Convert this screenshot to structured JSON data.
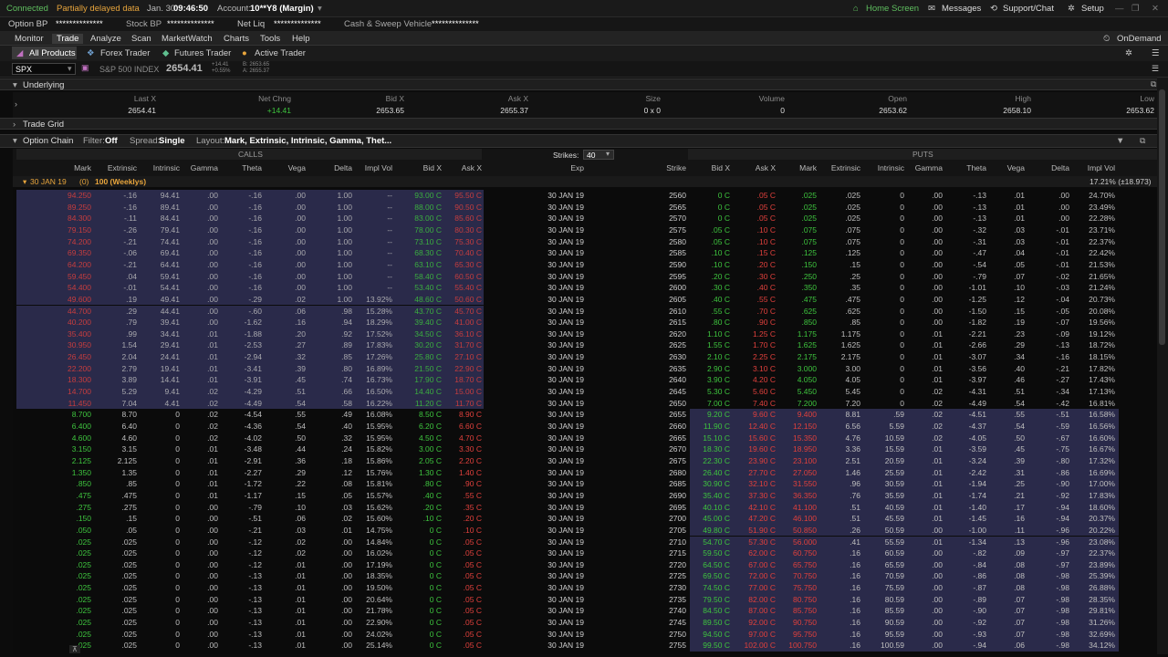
{
  "status": {
    "connected": "Connected",
    "delayed": "Partially delayed data",
    "date": "Jan. 30",
    "time": "09:46:50",
    "account_label": "Account:",
    "account": "10**Y8 (Margin)",
    "home": "Home Screen",
    "messages": "Messages",
    "support": "Support/Chat",
    "setup": "Setup"
  },
  "balances": {
    "obp_label": "Option BP",
    "obp": "**************",
    "sbp_label": "Stock BP",
    "sbp": "**************",
    "nl_label": "Net Liq",
    "nl": "**************",
    "cash_label": "Cash & Sweep Vehicle",
    "cash": "**************"
  },
  "menu": {
    "items": [
      "Monitor",
      "Trade",
      "Analyze",
      "Scan",
      "MarketWatch",
      "Charts",
      "Tools",
      "Help"
    ],
    "ondemand": "OnDemand"
  },
  "subtabs": {
    "all": "All Products",
    "forex": "Forex Trader",
    "futures": "Futures Trader",
    "active": "Active Trader"
  },
  "symbol": {
    "value": "SPX",
    "desc": "S&P 500 INDEX",
    "last": "2654.41",
    "chg": "+14.41",
    "pct": "+0.55%",
    "bid": "B: 2653.65",
    "ask": "A: 2655.37"
  },
  "underlying": {
    "title": "Underlying",
    "headers": [
      "Last X",
      "Net Chng",
      "Bid X",
      "Ask X",
      "Size",
      "Volume",
      "Open",
      "High",
      "Low"
    ],
    "values": [
      "2654.41",
      "+14.41",
      "2653.65",
      "2655.37",
      "0 x 0",
      "0",
      "2653.62",
      "2658.10",
      "2653.62"
    ]
  },
  "trade_grid": {
    "title": "Trade Grid"
  },
  "option_chain": {
    "title": "Option Chain",
    "filter_label": "Filter:",
    "filter": "Off",
    "spread_label": "Spread:",
    "spread": "Single",
    "layout_label": "Layout:",
    "layout": "Mark, Extrinsic, Intrinsic, Gamma, Thet...",
    "strikes_label": "Strikes:",
    "strikes": "40",
    "calls": "CALLS",
    "puts": "PUTS",
    "call_headers": [
      "Mark",
      "Extrinsic",
      "Intrinsic",
      "Gamma",
      "Theta",
      "Vega",
      "Delta",
      "Impl Vol",
      "Bid X",
      "Ask X"
    ],
    "mid_headers": [
      "Exp",
      "Strike"
    ],
    "put_headers": [
      "Bid X",
      "Ask X",
      "Mark",
      "Extrinsic",
      "Intrinsic",
      "Gamma",
      "Theta",
      "Vega",
      "Delta",
      "Impl Vol"
    ],
    "series_label": "30 JAN 19",
    "series_count": "(0)",
    "series_desc": "100 (Weeklys)",
    "series_iv": "17.21% (±18.973)"
  },
  "rows": [
    [
      "94.250",
      "-.16",
      "94.41",
      ".00",
      "-.16",
      ".00",
      "1.00",
      "--",
      "93.00 C",
      "95.50 C",
      "30 JAN 19",
      "2560",
      "0 C",
      ".05 C",
      ".025",
      ".025",
      "0",
      ".00",
      "-.13",
      ".01",
      ".00",
      "24.70%"
    ],
    [
      "89.250",
      "-.16",
      "89.41",
      ".00",
      "-.16",
      ".00",
      "1.00",
      "--",
      "88.00 C",
      "90.50 C",
      "30 JAN 19",
      "2565",
      "0 C",
      ".05 C",
      ".025",
      ".025",
      "0",
      ".00",
      "-.13",
      ".01",
      ".00",
      "23.49%"
    ],
    [
      "84.300",
      "-.11",
      "84.41",
      ".00",
      "-.16",
      ".00",
      "1.00",
      "--",
      "83.00 C",
      "85.60 C",
      "30 JAN 19",
      "2570",
      "0 C",
      ".05 C",
      ".025",
      ".025",
      "0",
      ".00",
      "-.13",
      ".01",
      ".00",
      "22.28%"
    ],
    [
      "79.150",
      "-.26",
      "79.41",
      ".00",
      "-.16",
      ".00",
      "1.00",
      "--",
      "78.00 C",
      "80.30 C",
      "30 JAN 19",
      "2575",
      ".05 C",
      ".10 C",
      ".075",
      ".075",
      "0",
      ".00",
      "-.32",
      ".03",
      "-.01",
      "23.71%"
    ],
    [
      "74.200",
      "-.21",
      "74.41",
      ".00",
      "-.16",
      ".00",
      "1.00",
      "--",
      "73.10 C",
      "75.30 C",
      "30 JAN 19",
      "2580",
      ".05 C",
      ".10 C",
      ".075",
      ".075",
      "0",
      ".00",
      "-.31",
      ".03",
      "-.01",
      "22.37%"
    ],
    [
      "69.350",
      "-.06",
      "69.41",
      ".00",
      "-.16",
      ".00",
      "1.00",
      "--",
      "68.30 C",
      "70.40 C",
      "30 JAN 19",
      "2585",
      ".10 C",
      ".15 C",
      ".125",
      ".125",
      "0",
      ".00",
      "-.47",
      ".04",
      "-.01",
      "22.42%"
    ],
    [
      "64.200",
      "-.21",
      "64.41",
      ".00",
      "-.16",
      ".00",
      "1.00",
      "--",
      "63.10 C",
      "65.30 C",
      "30 JAN 19",
      "2590",
      ".10 C",
      ".20 C",
      ".150",
      ".15",
      "0",
      ".00",
      "-.54",
      ".05",
      "-.01",
      "21.53%"
    ],
    [
      "59.450",
      ".04",
      "59.41",
      ".00",
      "-.16",
      ".00",
      "1.00",
      "--",
      "58.40 C",
      "60.50 C",
      "30 JAN 19",
      "2595",
      ".20 C",
      ".30 C",
      ".250",
      ".25",
      "0",
      ".00",
      "-.79",
      ".07",
      "-.02",
      "21.65%"
    ],
    [
      "54.400",
      "-.01",
      "54.41",
      ".00",
      "-.16",
      ".00",
      "1.00",
      "--",
      "53.40 C",
      "55.40 C",
      "30 JAN 19",
      "2600",
      ".30 C",
      ".40 C",
      ".350",
      ".35",
      "0",
      ".00",
      "-1.01",
      ".10",
      "-.03",
      "21.24%"
    ],
    [
      "49.600",
      ".19",
      "49.41",
      ".00",
      "-.29",
      ".02",
      "1.00",
      "13.92%",
      "48.60 C",
      "50.60 C",
      "30 JAN 19",
      "2605",
      ".40 C",
      ".55 C",
      ".475",
      ".475",
      "0",
      ".00",
      "-1.25",
      ".12",
      "-.04",
      "20.73%"
    ],
    [
      "44.700",
      ".29",
      "44.41",
      ".00",
      "-.60",
      ".06",
      ".98",
      "15.28%",
      "43.70 C",
      "45.70 C",
      "30 JAN 19",
      "2610",
      ".55 C",
      ".70 C",
      ".625",
      ".625",
      "0",
      ".00",
      "-1.50",
      ".15",
      "-.05",
      "20.08%"
    ],
    [
      "40.200",
      ".79",
      "39.41",
      ".00",
      "-1.62",
      ".16",
      ".94",
      "18.29%",
      "39.40 C",
      "41.00 C",
      "30 JAN 19",
      "2615",
      ".80 C",
      ".90 C",
      ".850",
      ".85",
      "0",
      ".00",
      "-1.82",
      ".19",
      "-.07",
      "19.56%"
    ],
    [
      "35.400",
      ".99",
      "34.41",
      ".01",
      "-1.88",
      ".20",
      ".92",
      "17.52%",
      "34.50 C",
      "36.10 C",
      "30 JAN 19",
      "2620",
      "1.10 C",
      "1.25 C",
      "1.175",
      "1.175",
      "0",
      ".01",
      "-2.21",
      ".23",
      "-.09",
      "19.12%"
    ],
    [
      "30.950",
      "1.54",
      "29.41",
      ".01",
      "-2.53",
      ".27",
      ".89",
      "17.83%",
      "30.20 C",
      "31.70 C",
      "30 JAN 19",
      "2625",
      "1.55 C",
      "1.70 C",
      "1.625",
      "1.625",
      "0",
      ".01",
      "-2.66",
      ".29",
      "-.13",
      "18.72%"
    ],
    [
      "26.450",
      "2.04",
      "24.41",
      ".01",
      "-2.94",
      ".32",
      ".85",
      "17.26%",
      "25.80 C",
      "27.10 C",
      "30 JAN 19",
      "2630",
      "2.10 C",
      "2.25 C",
      "2.175",
      "2.175",
      "0",
      ".01",
      "-3.07",
      ".34",
      "-.16",
      "18.15%"
    ],
    [
      "22.200",
      "2.79",
      "19.41",
      ".01",
      "-3.41",
      ".39",
      ".80",
      "16.89%",
      "21.50 C",
      "22.90 C",
      "30 JAN 19",
      "2635",
      "2.90 C",
      "3.10 C",
      "3.000",
      "3.00",
      "0",
      ".01",
      "-3.56",
      ".40",
      "-.21",
      "17.82%"
    ],
    [
      "18.300",
      "3.89",
      "14.41",
      ".01",
      "-3.91",
      ".45",
      ".74",
      "16.73%",
      "17.90 C",
      "18.70 C",
      "30 JAN 19",
      "2640",
      "3.90 C",
      "4.20 C",
      "4.050",
      "4.05",
      "0",
      ".01",
      "-3.97",
      ".46",
      "-.27",
      "17.43%"
    ],
    [
      "14.700",
      "5.29",
      "9.41",
      ".02",
      "-4.29",
      ".51",
      ".66",
      "16.50%",
      "14.40 C",
      "15.00 C",
      "30 JAN 19",
      "2645",
      "5.30 C",
      "5.60 C",
      "5.450",
      "5.45",
      "0",
      ".02",
      "-4.31",
      ".51",
      "-.34",
      "17.13%"
    ],
    [
      "11.450",
      "7.04",
      "4.41",
      ".02",
      "-4.49",
      ".54",
      ".58",
      "16.22%",
      "11.20 C",
      "11.70 C",
      "30 JAN 19",
      "2650",
      "7.00 C",
      "7.40 C",
      "7.200",
      "7.20",
      "0",
      ".02",
      "-4.49",
      ".54",
      "-.42",
      "16.81%"
    ],
    [
      "8.700",
      "8.70",
      "0",
      ".02",
      "-4.54",
      ".55",
      ".49",
      "16.08%",
      "8.50 C",
      "8.90 C",
      "30 JAN 19",
      "2655",
      "9.20 C",
      "9.60 C",
      "9.400",
      "8.81",
      ".59",
      ".02",
      "-4.51",
      ".55",
      "-.51",
      "16.58%"
    ],
    [
      "6.400",
      "6.40",
      "0",
      ".02",
      "-4.36",
      ".54",
      ".40",
      "15.95%",
      "6.20 C",
      "6.60 C",
      "30 JAN 19",
      "2660",
      "11.90 C",
      "12.40 C",
      "12.150",
      "6.56",
      "5.59",
      ".02",
      "-4.37",
      ".54",
      "-.59",
      "16.56%"
    ],
    [
      "4.600",
      "4.60",
      "0",
      ".02",
      "-4.02",
      ".50",
      ".32",
      "15.95%",
      "4.50 C",
      "4.70 C",
      "30 JAN 19",
      "2665",
      "15.10 C",
      "15.60 C",
      "15.350",
      "4.76",
      "10.59",
      ".02",
      "-4.05",
      ".50",
      "-.67",
      "16.60%"
    ],
    [
      "3.150",
      "3.15",
      "0",
      ".01",
      "-3.48",
      ".44",
      ".24",
      "15.82%",
      "3.00 C",
      "3.30 C",
      "30 JAN 19",
      "2670",
      "18.30 C",
      "19.60 C",
      "18.950",
      "3.36",
      "15.59",
      ".01",
      "-3.59",
      ".45",
      "-.75",
      "16.67%"
    ],
    [
      "2.125",
      "2.125",
      "0",
      ".01",
      "-2.91",
      ".36",
      ".18",
      "15.86%",
      "2.05 C",
      "2.20 C",
      "30 JAN 19",
      "2675",
      "22.30 C",
      "23.90 C",
      "23.100",
      "2.51",
      "20.59",
      ".01",
      "-3.24",
      ".39",
      "-.80",
      "17.32%"
    ],
    [
      "1.350",
      "1.35",
      "0",
      ".01",
      "-2.27",
      ".29",
      ".12",
      "15.76%",
      "1.30 C",
      "1.40 C",
      "30 JAN 19",
      "2680",
      "26.40 C",
      "27.70 C",
      "27.050",
      "1.46",
      "25.59",
      ".01",
      "-2.42",
      ".31",
      "-.86",
      "16.69%"
    ],
    [
      ".850",
      ".85",
      "0",
      ".01",
      "-1.72",
      ".22",
      ".08",
      "15.81%",
      ".80 C",
      ".90 C",
      "30 JAN 19",
      "2685",
      "30.90 C",
      "32.10 C",
      "31.550",
      ".96",
      "30.59",
      ".01",
      "-1.94",
      ".25",
      "-.90",
      "17.00%"
    ],
    [
      ".475",
      ".475",
      "0",
      ".01",
      "-1.17",
      ".15",
      ".05",
      "15.57%",
      ".40 C",
      ".55 C",
      "30 JAN 19",
      "2690",
      "35.40 C",
      "37.30 C",
      "36.350",
      ".76",
      "35.59",
      ".01",
      "-1.74",
      ".21",
      "-.92",
      "17.83%"
    ],
    [
      ".275",
      ".275",
      "0",
      ".00",
      "-.79",
      ".10",
      ".03",
      "15.62%",
      ".20 C",
      ".35 C",
      "30 JAN 19",
      "2695",
      "40.10 C",
      "42.10 C",
      "41.100",
      ".51",
      "40.59",
      ".01",
      "-1.40",
      ".17",
      "-.94",
      "18.60%"
    ],
    [
      ".150",
      ".15",
      "0",
      ".00",
      "-.51",
      ".06",
      ".02",
      "15.60%",
      ".10 C",
      ".20 C",
      "30 JAN 19",
      "2700",
      "45.00 C",
      "47.20 C",
      "46.100",
      ".51",
      "45.59",
      ".01",
      "-1.45",
      ".16",
      "-.94",
      "20.37%"
    ],
    [
      ".050",
      ".05",
      "0",
      ".00",
      "-.21",
      ".03",
      ".01",
      "14.75%",
      "0 C",
      ".10 C",
      "30 JAN 19",
      "2705",
      "49.80 C",
      "51.90 C",
      "50.850",
      ".26",
      "50.59",
      ".00",
      "-1.00",
      ".11",
      "-.96",
      "20.22%"
    ],
    [
      ".025",
      ".025",
      "0",
      ".00",
      "-.12",
      ".02",
      ".00",
      "14.84%",
      "0 C",
      ".05 C",
      "30 JAN 19",
      "2710",
      "54.70 C",
      "57.30 C",
      "56.000",
      ".41",
      "55.59",
      ".01",
      "-1.34",
      ".13",
      "-.96",
      "23.08%"
    ],
    [
      ".025",
      ".025",
      "0",
      ".00",
      "-.12",
      ".02",
      ".00",
      "16.02%",
      "0 C",
      ".05 C",
      "30 JAN 19",
      "2715",
      "59.50 C",
      "62.00 C",
      "60.750",
      ".16",
      "60.59",
      ".00",
      "-.82",
      ".09",
      "-.97",
      "22.37%"
    ],
    [
      ".025",
      ".025",
      "0",
      ".00",
      "-.12",
      ".01",
      ".00",
      "17.19%",
      "0 C",
      ".05 C",
      "30 JAN 19",
      "2720",
      "64.50 C",
      "67.00 C",
      "65.750",
      ".16",
      "65.59",
      ".00",
      "-.84",
      ".08",
      "-.97",
      "23.89%"
    ],
    [
      ".025",
      ".025",
      "0",
      ".00",
      "-.13",
      ".01",
      ".00",
      "18.35%",
      "0 C",
      ".05 C",
      "30 JAN 19",
      "2725",
      "69.50 C",
      "72.00 C",
      "70.750",
      ".16",
      "70.59",
      ".00",
      "-.86",
      ".08",
      "-.98",
      "25.39%"
    ],
    [
      ".025",
      ".025",
      "0",
      ".00",
      "-.13",
      ".01",
      ".00",
      "19.50%",
      "0 C",
      ".05 C",
      "30 JAN 19",
      "2730",
      "74.50 C",
      "77.00 C",
      "75.750",
      ".16",
      "75.59",
      ".00",
      "-.87",
      ".08",
      "-.98",
      "26.88%"
    ],
    [
      ".025",
      ".025",
      "0",
      ".00",
      "-.13",
      ".01",
      ".00",
      "20.64%",
      "0 C",
      ".05 C",
      "30 JAN 19",
      "2735",
      "79.50 C",
      "82.00 C",
      "80.750",
      ".16",
      "80.59",
      ".00",
      "-.89",
      ".07",
      "-.98",
      "28.35%"
    ],
    [
      ".025",
      ".025",
      "0",
      ".00",
      "-.13",
      ".01",
      ".00",
      "21.78%",
      "0 C",
      ".05 C",
      "30 JAN 19",
      "2740",
      "84.50 C",
      "87.00 C",
      "85.750",
      ".16",
      "85.59",
      ".00",
      "-.90",
      ".07",
      "-.98",
      "29.81%"
    ],
    [
      ".025",
      ".025",
      "0",
      ".00",
      "-.13",
      ".01",
      ".00",
      "22.90%",
      "0 C",
      ".05 C",
      "30 JAN 19",
      "2745",
      "89.50 C",
      "92.00 C",
      "90.750",
      ".16",
      "90.59",
      ".00",
      "-.92",
      ".07",
      "-.98",
      "31.26%"
    ],
    [
      ".025",
      ".025",
      "0",
      ".00",
      "-.13",
      ".01",
      ".00",
      "24.02%",
      "0 C",
      ".05 C",
      "30 JAN 19",
      "2750",
      "94.50 C",
      "97.00 C",
      "95.750",
      ".16",
      "95.59",
      ".00",
      "-.93",
      ".07",
      "-.98",
      "32.69%"
    ],
    [
      ".025",
      ".025",
      "0",
      ".00",
      "-.13",
      ".01",
      ".00",
      "25.14%",
      "0 C",
      ".05 C",
      "30 JAN 19",
      "2755",
      "99.50 C",
      "102.00 C",
      "100.750",
      ".16",
      "100.59",
      ".00",
      "-.94",
      ".06",
      "-.98",
      "34.12%"
    ]
  ],
  "itm_call_rows": 19,
  "colors": {
    "itm_bg": "#2a2a4a",
    "green": "#3ec43e",
    "red": "#e0403c",
    "orange": "#e8a53c",
    "header_bg": "#1f1f1f",
    "brand_green": "#5fbf5f"
  }
}
